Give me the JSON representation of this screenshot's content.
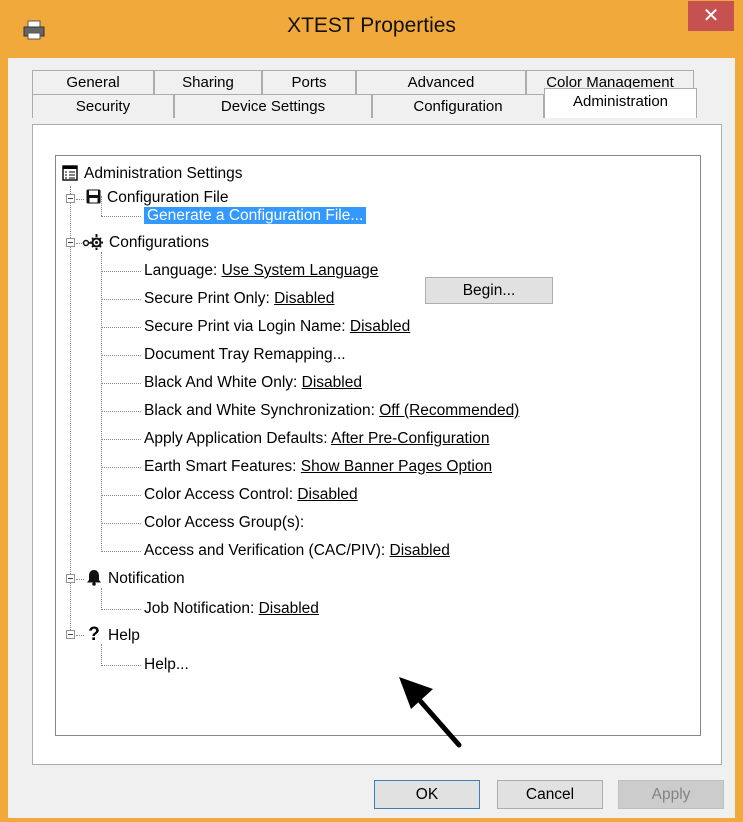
{
  "window": {
    "title": "XTEST Properties",
    "close_glyph": "✕",
    "title_icon": "printer-icon",
    "accent": "#f2a93b"
  },
  "tabs": {
    "row_back": [
      "General",
      "Sharing",
      "Ports",
      "Advanced",
      "Color Management"
    ],
    "row_front": [
      "Security",
      "Device Settings",
      "Configuration",
      "Administration"
    ],
    "active": "Administration"
  },
  "tree": {
    "root": "Administration Settings",
    "config_file": {
      "label": "Configuration File",
      "generate": "Generate a Configuration File...",
      "begin_button": "Begin..."
    },
    "configurations": {
      "label": "Configurations",
      "items": [
        {
          "name": "Language:",
          "value": "Use System Language"
        },
        {
          "name": "Secure Print Only:",
          "value": "Disabled"
        },
        {
          "name": "Secure Print via Login Name:",
          "value": "Disabled"
        },
        {
          "name": "Document Tray Remapping...",
          "value": ""
        },
        {
          "name": "Black And White Only:",
          "value": "Disabled"
        },
        {
          "name": "Black and White Synchronization:",
          "value": "Off (Recommended)"
        },
        {
          "name": "Apply Application Defaults:",
          "value": "After Pre-Configuration"
        },
        {
          "name": "Earth Smart Features:",
          "value": "Show Banner Pages Option"
        },
        {
          "name": "Color Access Control:",
          "value": "Disabled"
        },
        {
          "name": "Color Access Group(s):",
          "value": ""
        },
        {
          "name": "Access and Verification (CAC/PIV):",
          "value": "Disabled"
        }
      ]
    },
    "notification": {
      "label": "Notification",
      "items": [
        {
          "name": "Job Notification:",
          "value": "Disabled"
        }
      ]
    },
    "help": {
      "label": "Help",
      "icon_glyph": "?",
      "items": [
        {
          "name": "Help...",
          "value": ""
        }
      ]
    }
  },
  "buttons": {
    "ok": "OK",
    "cancel": "Cancel",
    "apply": "Apply"
  }
}
